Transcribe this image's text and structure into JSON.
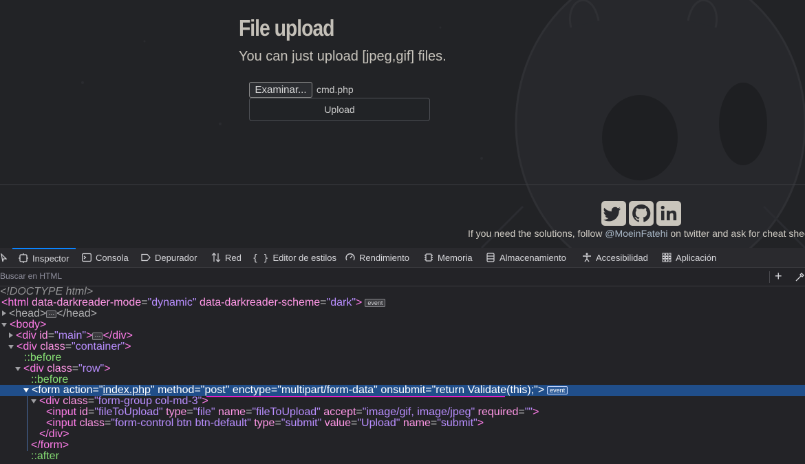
{
  "page": {
    "title": "File upload",
    "subtitle": "You can just upload [jpeg,gif] files.",
    "file_button": "Examinar...",
    "file_name": "cmd.php",
    "upload_button": "Upload",
    "footer_text_before": "If you need the solutions, follow ",
    "footer_handle": "@MoeinFatehi",
    "footer_text_after": " on twitter and ask for cheat shee",
    "social_icons": [
      "twitter-icon",
      "github-icon",
      "linkedin-icon"
    ]
  },
  "devtools": {
    "tabs": [
      {
        "label": "Inspector",
        "icon": "inspector-icon"
      },
      {
        "label": "Consola",
        "icon": "console-icon"
      },
      {
        "label": "Depurador",
        "icon": "debugger-icon"
      },
      {
        "label": "Red",
        "icon": "network-icon"
      },
      {
        "label": "Editor de estilos",
        "icon": "style-editor-icon"
      },
      {
        "label": "Rendimiento",
        "icon": "performance-icon"
      },
      {
        "label": "Memoria",
        "icon": "memory-icon"
      },
      {
        "label": "Almacenamiento",
        "icon": "storage-icon"
      },
      {
        "label": "Accesibilidad",
        "icon": "accessibility-icon"
      },
      {
        "label": "Aplicación",
        "icon": "application-icon"
      }
    ],
    "search_placeholder": "Buscar en HTML",
    "event_badge": "event",
    "ellipsis": "⋯",
    "tree": {
      "doctype": "<!DOCTYPE html>",
      "html_tag": "html",
      "html_attr1_name": "data-darkreader-mode",
      "html_attr1_value": "\"dynamic\"",
      "html_attr2_name": "data-darkreader-scheme",
      "html_attr2_value": "\"dark\"",
      "head_open": "<head>",
      "head_close": "</head>",
      "body_tag": "<body>",
      "div_tag": "div",
      "main_attr_name": "id",
      "main_attr_value": "\"main\"",
      "div_close": "</div>",
      "class_attr": "class",
      "container_value": "\"container\"",
      "before": "::before",
      "row_value": "\"row\"",
      "form_tag": "form",
      "form_action_name": "action",
      "form_action_value": "index.php",
      "form_method_name": "method",
      "form_method_value": "\"post\"",
      "form_enctype_name": "enctype",
      "form_enctype_value": "\"multipart/form-data\"",
      "form_onsubmit_name": "onsubmit",
      "form_onsubmit_value": "\"return Validate(this);\"",
      "formgroup_value": "\"form-group col-md-3\"",
      "input_tag": "input",
      "input1_id_value": "\"fileToUpload\"",
      "type_attr": "type",
      "input1_type_value": "\"file\"",
      "name_attr": "name",
      "input1_name_value": "\"fileToUpload\"",
      "accept_attr": "accept",
      "input1_accept_value": "\"image/gif, image/jpeg\"",
      "required_attr": "required",
      "required_value": "\"\"",
      "input2_class_value": "\"form-control btn btn-default\"",
      "input2_type_value": "\"submit\"",
      "value_attr": "value",
      "input2_value_value": "\"Upload\"",
      "input2_name_value": "\"submit\"",
      "form_close": "</form>",
      "after": "::after"
    }
  },
  "colors": {
    "accent": "#0a84ff",
    "selection": "#204e8a",
    "highlight_underline": "#e61ec8",
    "tag": "#ff7de9",
    "attr_value": "#b98eff",
    "pseudo": "#86de74"
  }
}
